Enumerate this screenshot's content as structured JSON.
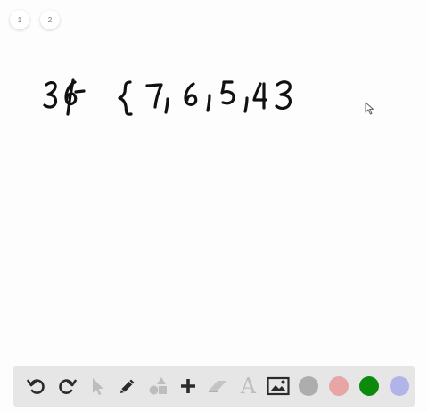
{
  "pages": [
    "1",
    "2"
  ],
  "toolbar": {
    "undo_icon": "undo-icon",
    "redo_icon": "redo-icon",
    "select_icon": "pointer-icon",
    "pen_icon": "pen-icon",
    "shapes_icon": "shapes-icon",
    "add_icon": "plus-icon",
    "eraser_icon": "eraser-icon",
    "text_tool_label": "A",
    "image_icon": "image-icon"
  },
  "colors": {
    "toolbar_bg": "#e6e6e6",
    "icon_active": "#2b2b2b",
    "icon_disabled": "#bdbdbd",
    "swatch_gray": "#adadad",
    "swatch_pink": "#e8a5a5",
    "swatch_green": "#0b8a0b",
    "swatch_lavender": "#b0b4e8",
    "ink": "#111111"
  }
}
